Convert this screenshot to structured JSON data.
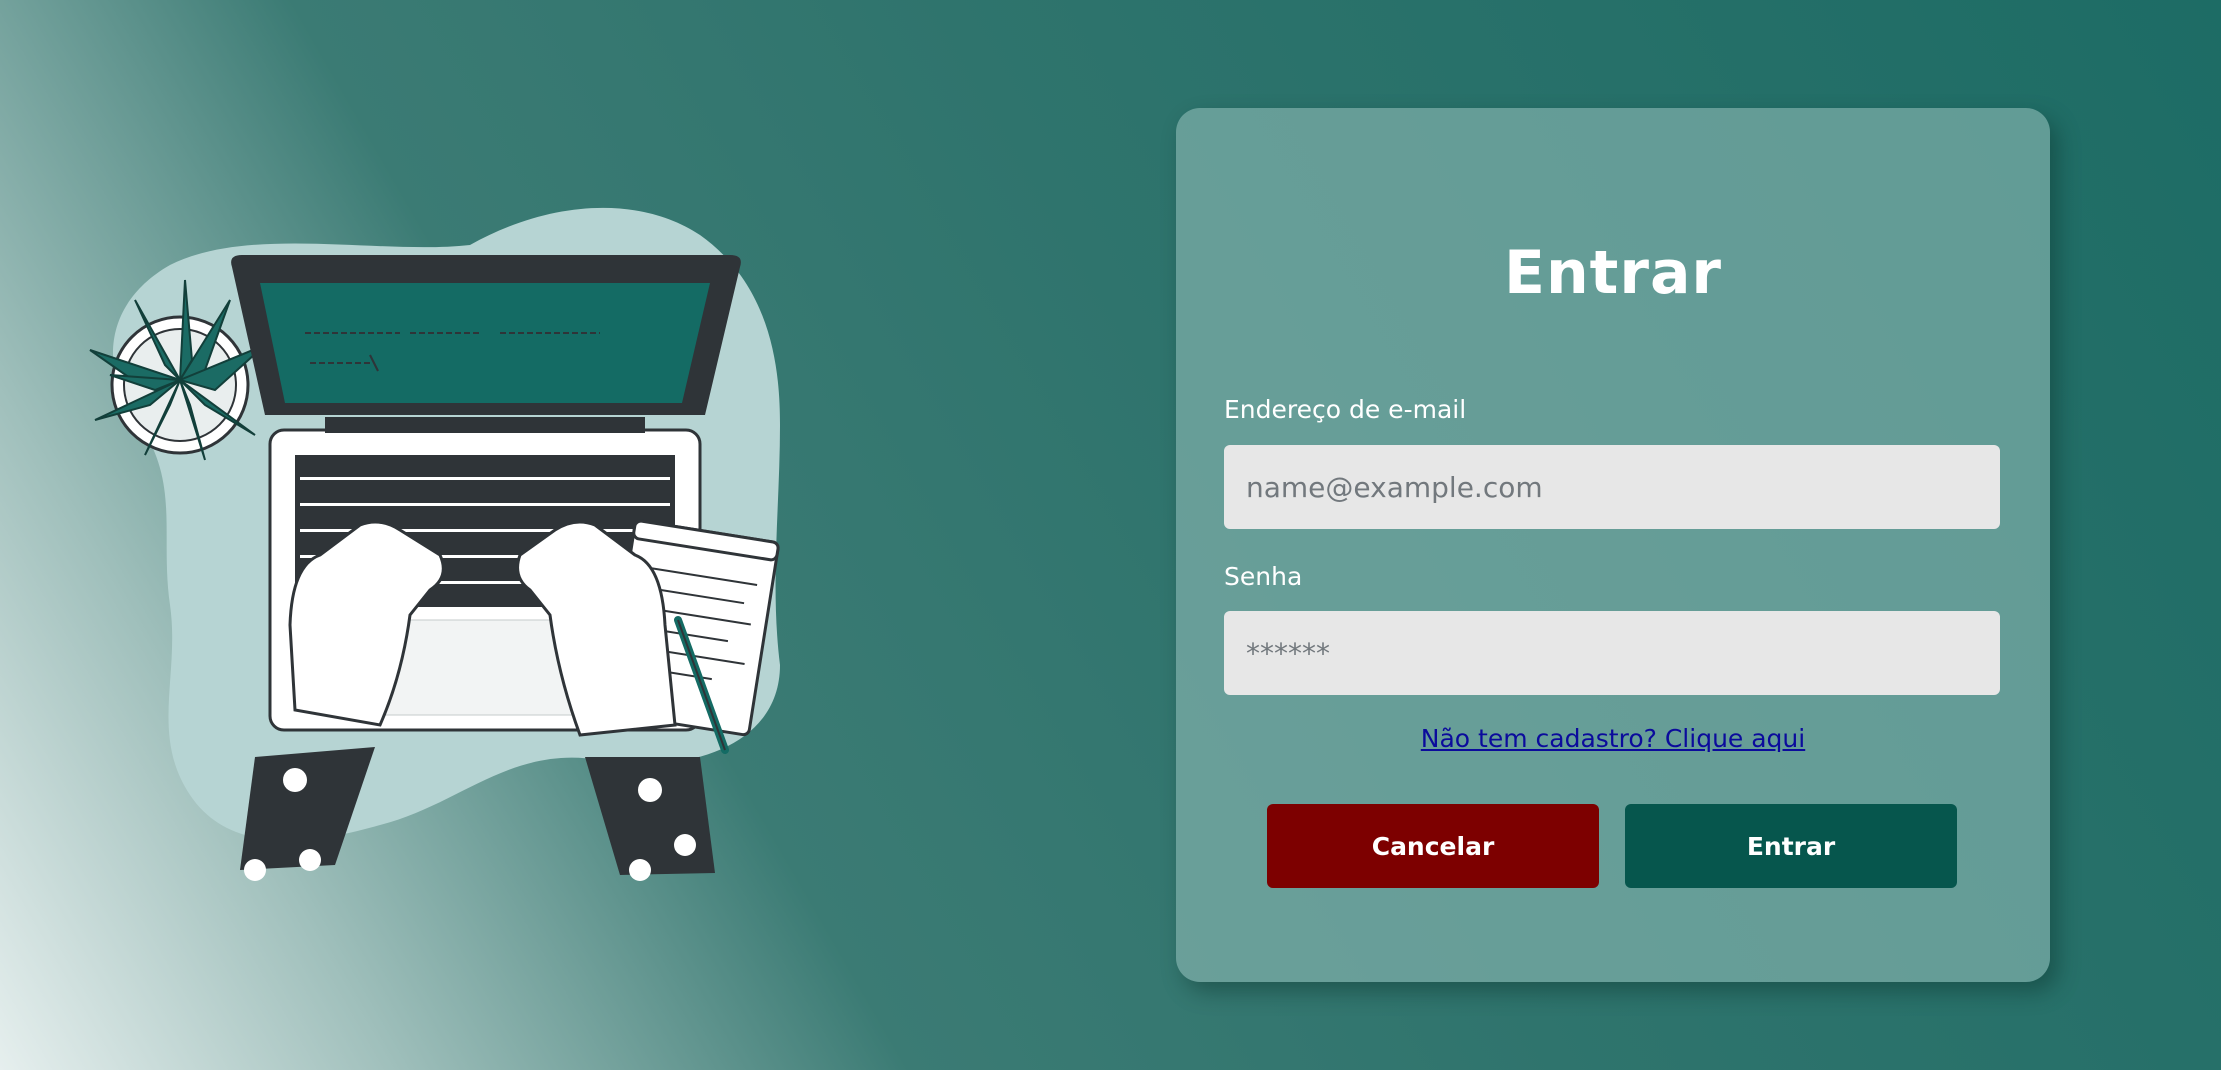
{
  "login": {
    "title": "Entrar",
    "email": {
      "label": "Endereço de e-mail",
      "placeholder": "name@example.com",
      "value": ""
    },
    "password": {
      "label": "Senha",
      "placeholder": "******",
      "value": ""
    },
    "signup_link": "Não tem cadastro? Clique aqui",
    "cancel_label": "Cancelar",
    "submit_label": "Entrar"
  },
  "colors": {
    "cancel": "#7d0000",
    "submit": "#06564d",
    "link": "#0b0b9c",
    "input_bg": "#e7e7e7"
  },
  "illustration": {
    "icon": "laptop-typing-illustration"
  }
}
